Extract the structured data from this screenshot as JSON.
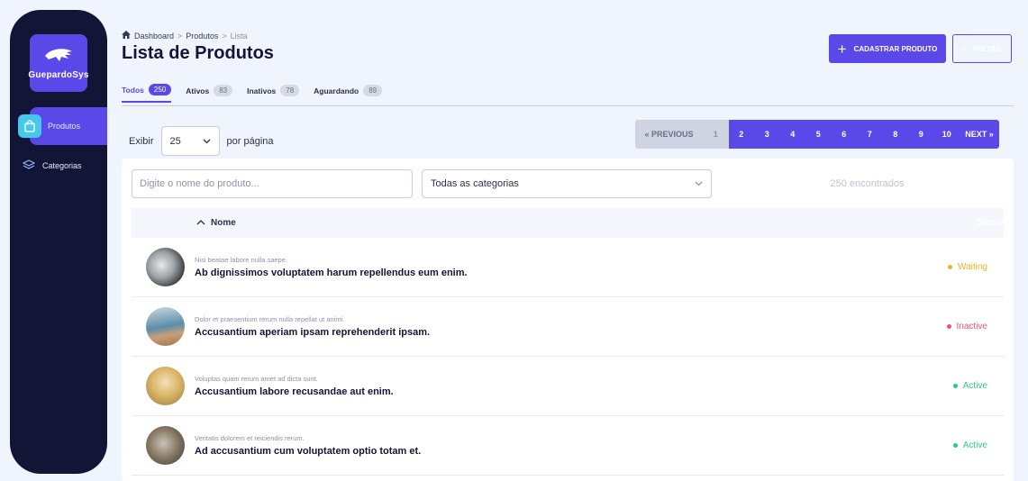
{
  "brand": {
    "name": "GuepardoSys",
    "accent": "#5b48e8",
    "sidebar_bg": "#131537"
  },
  "sidebar": {
    "items": [
      {
        "label": "Produtos",
        "icon": "shopping-bag-icon",
        "active": true
      },
      {
        "label": "Categorias",
        "icon": "layers-icon",
        "active": false
      }
    ]
  },
  "breadcrumb": {
    "home": "Dashboard",
    "sep1": ">",
    "level1": "Produtos",
    "sep2": ">",
    "current": "Lista"
  },
  "page": {
    "title": "Lista de Produtos"
  },
  "tabs": [
    {
      "label": "Todos",
      "count": "250"
    },
    {
      "label": "Ativos",
      "count": "83"
    },
    {
      "label": "Inativos",
      "count": "78"
    },
    {
      "label": "Aguardando",
      "count": "89"
    }
  ],
  "actions": {
    "create_label": "CADASTRAR PRODUTO",
    "back_label": "VOLTAR"
  },
  "pagination": {
    "show_label": "Exibir",
    "per_page": "25",
    "per_page_suffix": "por página",
    "prev": "« PREVIOUS",
    "pages": [
      "1",
      "2",
      "3",
      "4",
      "5",
      "6",
      "7",
      "8",
      "9",
      "10"
    ],
    "current": "1",
    "next": "NEXT »"
  },
  "filters": {
    "search_placeholder": "Digite o nome do produto...",
    "category_value": "Todas as categorias",
    "result_count": "250 encontrados"
  },
  "table": {
    "col_name": "Nome",
    "col_status": "Status",
    "rows": [
      {
        "subtitle": "Nisi beatae labore nulla saepe.",
        "name": "Ab dignissimos voluptatem harum repellendus eum enim.",
        "status": "Waiting",
        "status_color": "#f0b323"
      },
      {
        "subtitle": "Dolor et praesentium rerum nulla repellat ut animi.",
        "name": "Accusantium aperiam ipsam reprehenderit ipsam.",
        "status": "Inactive",
        "status_color": "#f0536a"
      },
      {
        "subtitle": "Voluptas quam rerum amet ad dicta sunt.",
        "name": "Accusantium labore recusandae aut enim.",
        "status": "Active",
        "status_color": "#2ec98a"
      },
      {
        "subtitle": "Veritatis dolorem et reiciendis rerum.",
        "name": "Ad accusantium cum voluptatem optio totam et.",
        "status": "Active",
        "status_color": "#2ec98a"
      }
    ]
  }
}
